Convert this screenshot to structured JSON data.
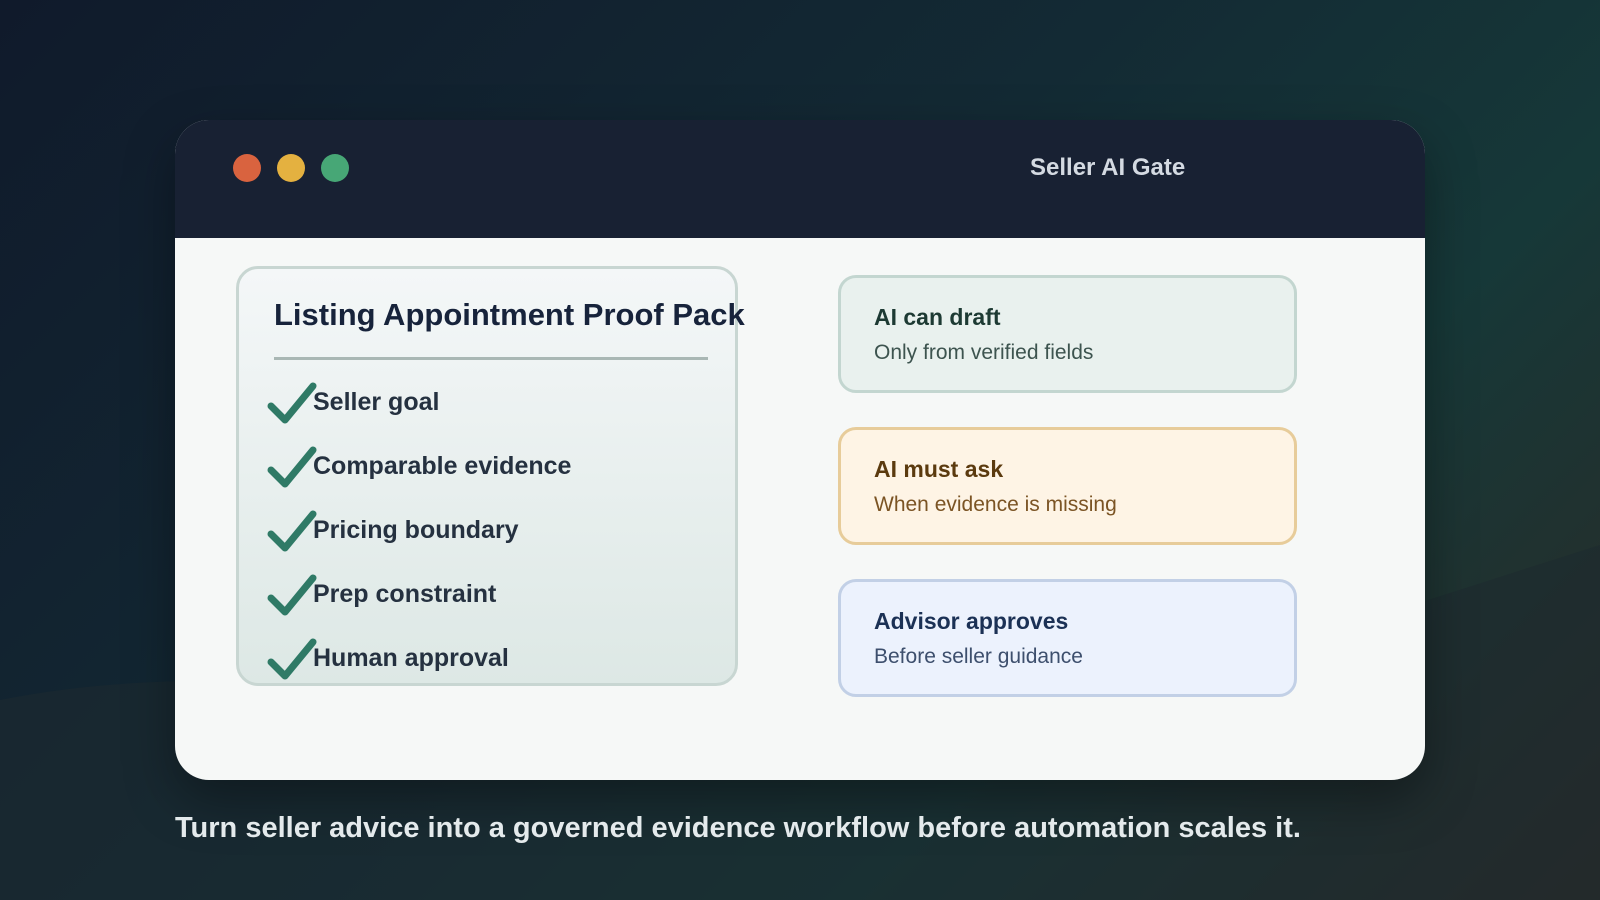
{
  "window": {
    "title": "Seller AI Gate"
  },
  "proof_pack": {
    "title": "Listing Appointment Proof Pack",
    "items": [
      {
        "label": "Seller goal",
        "icon": "checkmark-icon"
      },
      {
        "label": "Comparable evidence",
        "icon": "checkmark-icon"
      },
      {
        "label": "Pricing boundary",
        "icon": "checkmark-icon"
      },
      {
        "label": "Prep constraint",
        "icon": "checkmark-icon"
      },
      {
        "label": "Human approval",
        "icon": "checkmark-icon"
      }
    ]
  },
  "gates": [
    {
      "title": "AI can draft",
      "subtitle": "Only from verified fields"
    },
    {
      "title": "AI must ask",
      "subtitle": "When evidence is missing"
    },
    {
      "title": "Advisor approves",
      "subtitle": "Before seller guidance"
    }
  ],
  "caption": "Turn seller advice into a governed evidence workflow before automation scales it.",
  "colors": {
    "check": "#2f7a66",
    "traffic_red": "#d9633f",
    "traffic_yellow": "#e4b140",
    "traffic_green": "#47a776"
  }
}
